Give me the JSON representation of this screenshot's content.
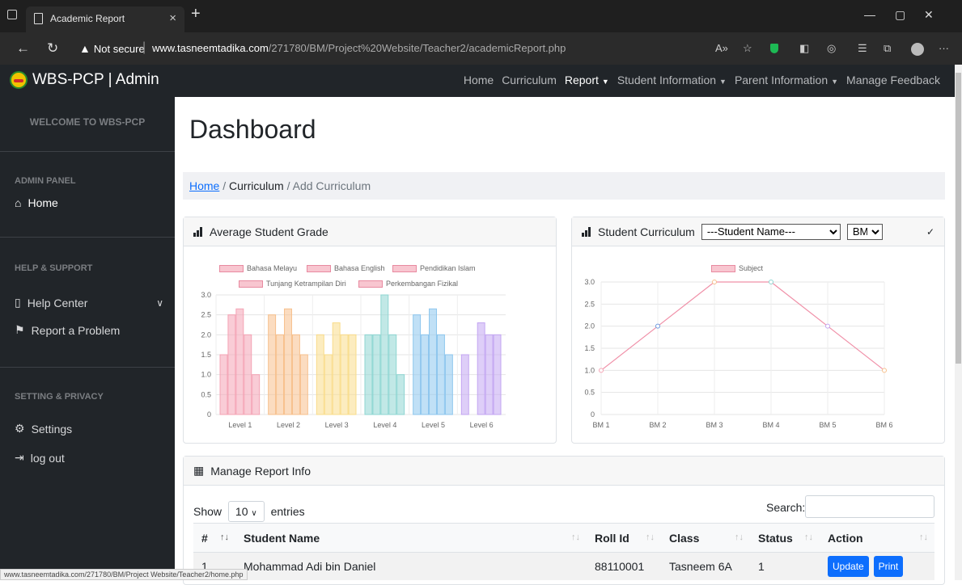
{
  "browser": {
    "tab_title": "Academic Report",
    "not_secure": "Not secure",
    "url_host": "www.tasneemtadika.com",
    "url_path": "/271780/BM/Project%20Website/Teacher2/academicReport.php",
    "status_url": "www.tasneemtadika.com/271780/BM/Project Website/Teacher2/home.php"
  },
  "navbar": {
    "brand": "WBS-PCP | Admin",
    "items": [
      {
        "label": "Home"
      },
      {
        "label": "Curriculum"
      },
      {
        "label": "Report",
        "dropdown": true,
        "active": true
      },
      {
        "label": "Student Information",
        "dropdown": true
      },
      {
        "label": "Parent Information",
        "dropdown": true
      },
      {
        "label": "Manage Feedback"
      }
    ]
  },
  "sidebar": {
    "welcome": "WELCOME TO WBS-PCP",
    "admin_panel": "ADMIN PANEL",
    "home": "Home",
    "help_support": "HELP & SUPPORT",
    "help_center": "Help Center",
    "report_problem": "Report a Problem",
    "setting_privacy": "SETTING & PRIVACY",
    "settings": "Settings",
    "logout": "log out"
  },
  "main": {
    "title": "Dashboard",
    "breadcrumb": {
      "home": "Home",
      "curriculum": "Curriculum",
      "current": "Add Curriculum"
    }
  },
  "grade_card": {
    "title": "Average Student Grade"
  },
  "curr_card": {
    "title": "Student Curriculum",
    "student_select": "---Student Name---",
    "subject_select": "BM"
  },
  "chart_data": [
    {
      "type": "bar",
      "categories": [
        "Level 1",
        "Level 2",
        "Level 3",
        "Level 4",
        "Level 5",
        "Level 6"
      ],
      "series": [
        {
          "name": "Bahasa Melayu",
          "values": [
            1.5,
            2.5,
            2.0,
            2.0,
            2.5,
            1.5
          ]
        },
        {
          "name": "Bahasa English",
          "values": [
            2.5,
            2.0,
            1.5,
            2.0,
            2.0,
            0
          ]
        },
        {
          "name": "Pendidikan Islam",
          "values": [
            2.65,
            2.65,
            2.3,
            3.0,
            2.65,
            2.3
          ]
        },
        {
          "name": "Tunjang Ketrampilan Diri",
          "values": [
            2.0,
            2.0,
            2.0,
            2.0,
            2.0,
            2.0
          ]
        },
        {
          "name": "Perkembangan Fizikal",
          "values": [
            1.0,
            1.5,
            2.0,
            1.0,
            1.5,
            2.0
          ]
        }
      ],
      "ylim": [
        0,
        3
      ],
      "yticks": [
        "0",
        "0.5",
        "1.0",
        "1.5",
        "2.0",
        "2.5",
        "3.0"
      ],
      "colors": [
        "#f4a3b4",
        "#f7c08c",
        "#f9dc8a",
        "#8ed6d2",
        "#8dc6ee",
        "#c3a6f2"
      ],
      "legend": "top"
    },
    {
      "type": "line",
      "categories": [
        "BM 1",
        "BM 2",
        "BM 3",
        "BM 4",
        "BM 5",
        "BM 6"
      ],
      "series": [
        {
          "name": "Subject",
          "values": [
            1.0,
            2.0,
            3.0,
            3.0,
            2.0,
            1.0
          ]
        }
      ],
      "ylim": [
        0,
        3
      ],
      "yticks": [
        "0",
        "0.5",
        "1.0",
        "1.5",
        "2.0",
        "2.5",
        "3.0"
      ],
      "legend": "top"
    }
  ],
  "report_card": {
    "title": "Manage Report Info",
    "show": "Show",
    "entries_value": "10",
    "entries": "entries",
    "search": "Search:",
    "columns": [
      "#",
      "Student Name",
      "Roll Id",
      "Class",
      "Status",
      "Action"
    ],
    "rows": [
      {
        "no": "1",
        "name": "Mohammad Adi bin Daniel",
        "roll": "88110001",
        "class": "Tasneem 6A",
        "status": "1"
      }
    ],
    "update": "Update",
    "print": "Print"
  }
}
